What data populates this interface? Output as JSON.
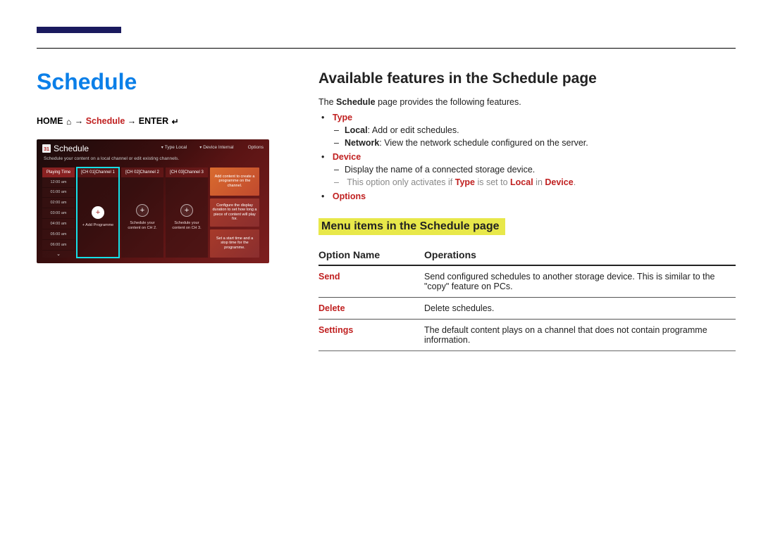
{
  "page_title": "Schedule",
  "breadcrumb": {
    "home": "HOME",
    "arrow": "→",
    "schedule": "Schedule",
    "enter": "ENTER"
  },
  "screenshot": {
    "calendar_day": "31",
    "title": "Schedule",
    "menu": {
      "type": "Type Local",
      "device": "Device Internal",
      "options": "Options"
    },
    "subtitle": "Schedule your content on a local channel or edit existing channels.",
    "times_header": "Playing Time",
    "times": [
      "12:00 am",
      "01:00 am",
      "02:00 am",
      "03:00 am",
      "04:00 am",
      "05:00 am",
      "06:00 am"
    ],
    "channels": [
      {
        "header": "[CH 01]Channel 1",
        "caption": "+ Add Programme"
      },
      {
        "header": "[CH 02]Channel 2",
        "caption": "Schedule your content on CH 2."
      },
      {
        "header": "[CH 03]Channel 3",
        "caption": "Schedule your content on CH 3."
      }
    ],
    "cards": [
      "Add content to create a programme on the channel.",
      "Configure the display duration to set how long a piece of content will play for.",
      "Set a start time and a stop time for the programme."
    ]
  },
  "features": {
    "heading": "Available features in the Schedule page",
    "intro_pre": "The ",
    "intro_bold": "Schedule",
    "intro_post": " page provides the following features.",
    "type": {
      "label": "Type",
      "local_k": "Local",
      "local_v": ": Add or edit schedules.",
      "network_k": "Network",
      "network_v": ": View the network schedule configured on the server."
    },
    "device": {
      "label": "Device",
      "line1": "Display the name of a connected storage device.",
      "note_pre": "This option only activates if ",
      "note_t": "Type",
      "note_mid": " is set to ",
      "note_l": "Local",
      "note_mid2": " in ",
      "note_d": "Device",
      "note_end": "."
    },
    "options_label": "Options"
  },
  "menu": {
    "heading": "Menu items in the Schedule page",
    "col_name": "Option Name",
    "col_ops": "Operations",
    "rows": [
      {
        "name": "Send",
        "ops": "Send configured schedules to another storage device. This is similar to the \"copy\" feature on PCs."
      },
      {
        "name": "Delete",
        "ops": "Delete schedules."
      },
      {
        "name": "Settings",
        "ops": "The default content plays on a channel that does not contain programme information."
      }
    ]
  }
}
